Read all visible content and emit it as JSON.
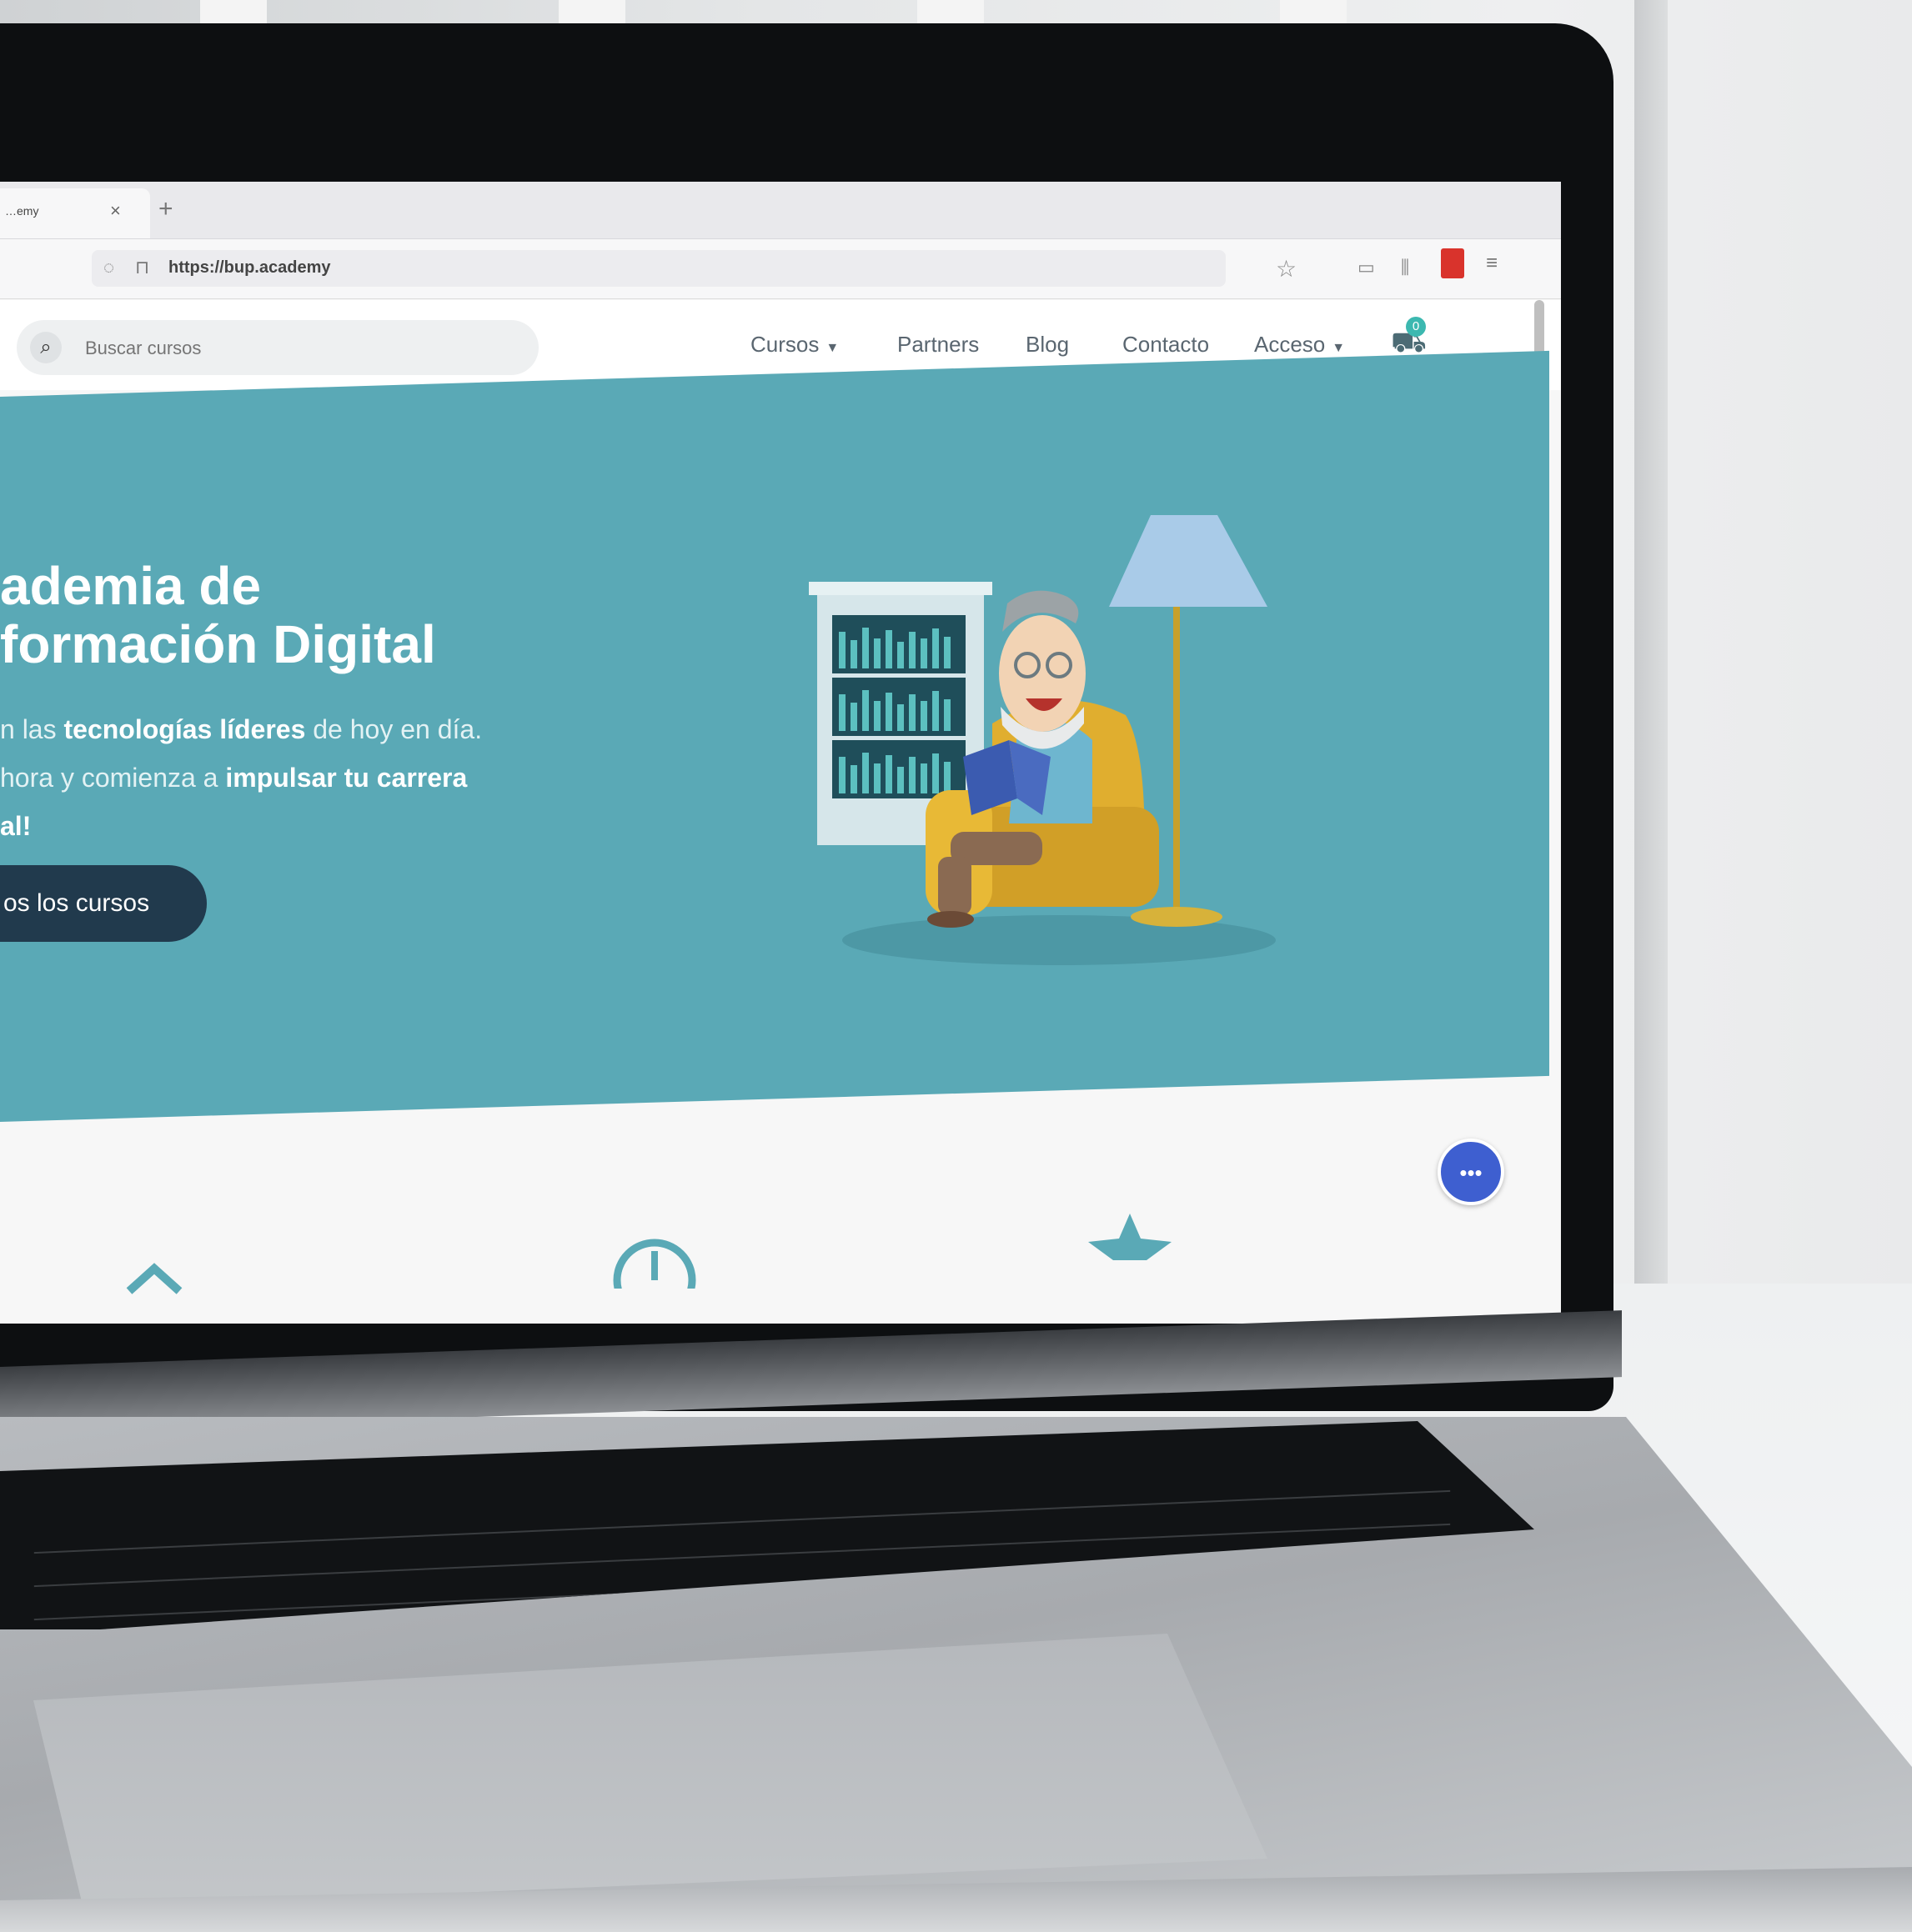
{
  "browser": {
    "tab_title": "…emy",
    "tab_close": "×",
    "new_tab": "+",
    "url": "https://bup.academy"
  },
  "nav": {
    "search_placeholder": "Buscar cursos",
    "items": [
      {
        "label": "Cursos",
        "has_dropdown": true
      },
      {
        "label": "Partners",
        "has_dropdown": false
      },
      {
        "label": "Blog",
        "has_dropdown": false
      },
      {
        "label": "Contacto",
        "has_dropdown": false
      },
      {
        "label": "Acceso",
        "has_dropdown": true
      }
    ],
    "cart_count": "0"
  },
  "hero": {
    "title_line1": "ademia de",
    "title_line2": "formación Digital",
    "sub_line1_pre": "n las ",
    "sub_line1_bold": "tecnologías líderes",
    "sub_line1_post": " de hoy en día.",
    "sub_line2_pre": "hora y comienza a ",
    "sub_line2_bold": "impulsar tu carrera",
    "sub_line3": "al!",
    "button_label": "os los cursos",
    "background_color": "#5aa9b6"
  },
  "chat": {
    "icon": "chat-bubble-icon"
  },
  "icons": {
    "search": "search-icon",
    "cart": "cart-icon",
    "bookmark": "star-icon"
  }
}
